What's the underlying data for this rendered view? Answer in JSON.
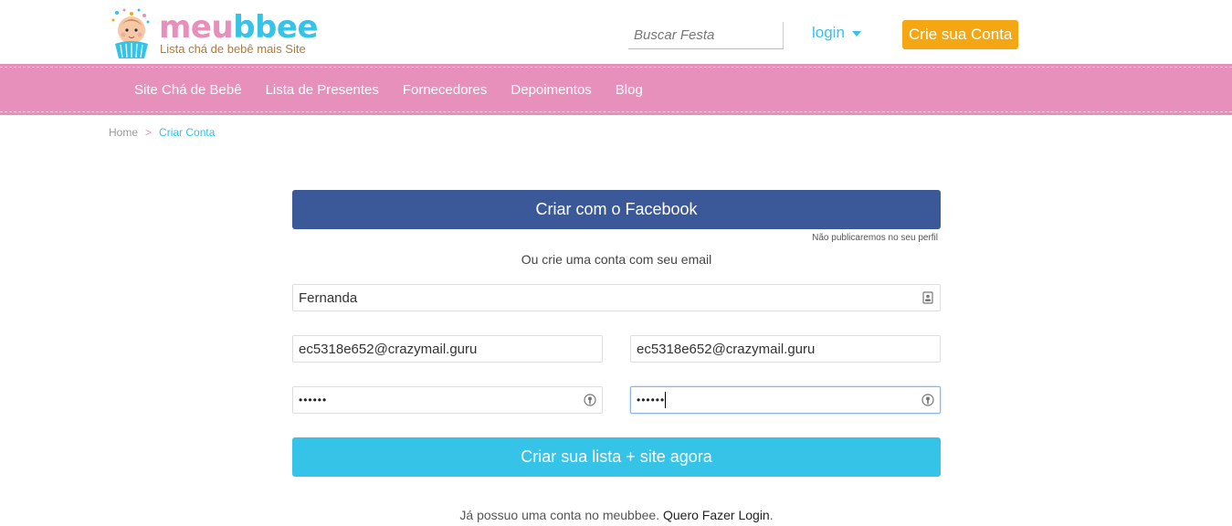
{
  "header": {
    "logo_meu": "meu",
    "logo_bbee": "bbee",
    "logo_tagline": "Lista chá de bebê mais Site",
    "search_placeholder": "Buscar Festa",
    "login_label": "login",
    "create_account_label": "Crie sua Conta"
  },
  "nav": {
    "items": [
      {
        "label": "Site Chá de Bebê"
      },
      {
        "label": "Lista de Presentes"
      },
      {
        "label": "Fornecedores"
      },
      {
        "label": "Depoimentos"
      },
      {
        "label": "Blog"
      }
    ]
  },
  "breadcrumb": {
    "home": "Home",
    "separator": ">",
    "current": "Criar Conta"
  },
  "form": {
    "facebook_button": "Criar com o Facebook",
    "facebook_note": "Não publicaremos no seu perfil",
    "or_text": "Ou crie uma conta com seu email",
    "name_value": "Fernanda",
    "email_value": "ec5318e652@crazymail.guru",
    "email_confirm_value": "ec5318e652@crazymail.guru",
    "password_mask": "••••••",
    "password_confirm_mask": "••••••",
    "submit_button": "Criar sua lista + site agora",
    "login_prompt": "Já possuo uma conta no meubbee.",
    "login_link": "Quero Fazer Login"
  },
  "colors": {
    "brand_pink": "#e690bb",
    "brand_blue": "#35c3e8",
    "cta_orange": "#f5a613",
    "facebook_blue": "#3b5998"
  }
}
